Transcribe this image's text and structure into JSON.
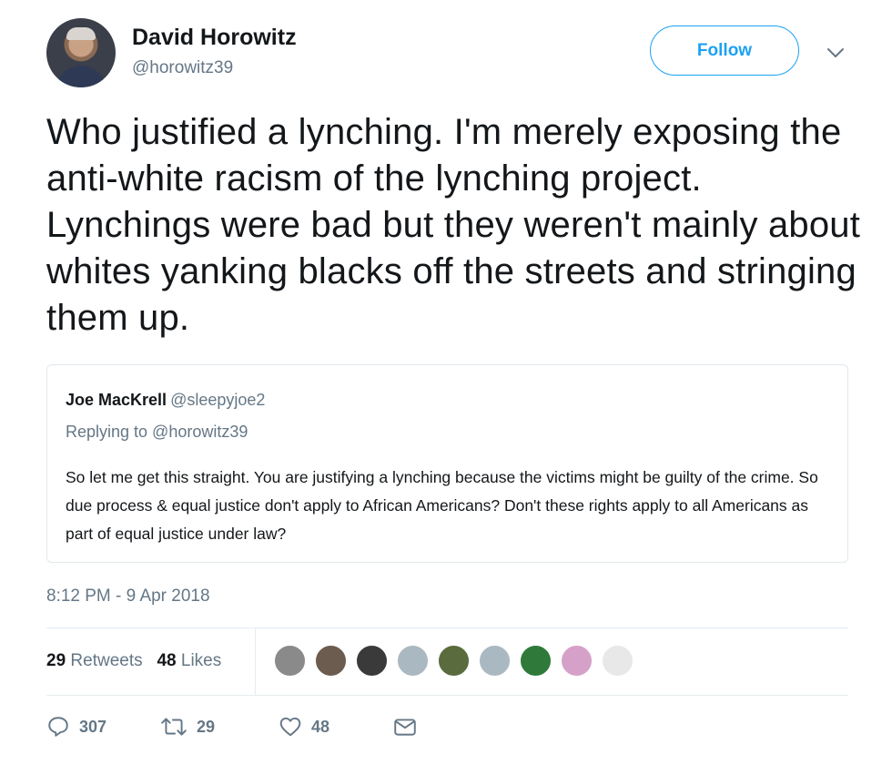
{
  "author": {
    "name": "David Horowitz",
    "handle": "@horowitz39"
  },
  "follow_label": "Follow",
  "tweet_text": "Who justified a lynching. I'm merely exposing the anti-white racism of the lynching project. Lynchings were bad but they weren't mainly about whites yanking blacks off the streets and stringing them up.",
  "quoted": {
    "name": "Joe MacKrell",
    "handle": "@sleepyjoe2",
    "replying": "Replying to @horowitz39",
    "text": "So let me get this straight. You are justifying a lynching because the victims might be guilty of the crime. So due process & equal justice don't apply to African Americans? Don't these rights apply to all Americans  as part of equal justice under law?"
  },
  "timestamp": "8:12 PM - 9 Apr 2018",
  "stats": {
    "retweets_count": "29",
    "retweets_label": "Retweets",
    "likes_count": "48",
    "likes_label": "Likes"
  },
  "liker_avatars": [
    "#8a8a8a",
    "#6b5c4f",
    "#3a3a3a",
    "#aab8c2",
    "#5a6b3e",
    "#aab8c2",
    "#2f7a3a",
    "#d6a1c8",
    "#e8e8e8"
  ],
  "actions": {
    "replies": "307",
    "retweets": "29",
    "likes": "48"
  },
  "colors": {
    "accent": "#1da1f2",
    "secondary_text": "#657786"
  }
}
